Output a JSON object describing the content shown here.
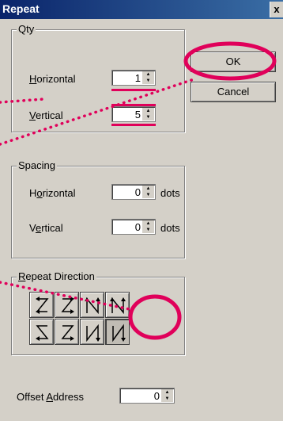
{
  "window": {
    "title": "Repeat",
    "close_glyph": "x"
  },
  "qty": {
    "label": "Qty",
    "horizontal": {
      "label_prefix": "",
      "label_ul": "H",
      "label_rest": "orizontal",
      "value": "1"
    },
    "vertical": {
      "label_prefix": "",
      "label_ul": "V",
      "label_rest": "ertical",
      "value": "5"
    }
  },
  "buttons": {
    "ok": "OK",
    "cancel": "Cancel"
  },
  "spacing": {
    "label": "Spacing",
    "horizontal": {
      "label_prefix": "H",
      "label_ul": "o",
      "label_rest": "rizontal",
      "value": "0",
      "unit": "dots"
    },
    "vertical": {
      "label_prefix": "V",
      "label_ul": "e",
      "label_rest": "rtical",
      "value": "0",
      "unit": "dots"
    }
  },
  "repeat_direction": {
    "label_ul": "R",
    "label_rest": "epeat Direction",
    "selected_index": 7
  },
  "offset": {
    "label_prefix": "Offset ",
    "label_ul": "A",
    "label_rest": "ddress",
    "value": "0"
  },
  "colors": {
    "highlight": "#e0005a",
    "dialog_bg": "#d4d0c8",
    "title_bar": "#0a246a"
  }
}
